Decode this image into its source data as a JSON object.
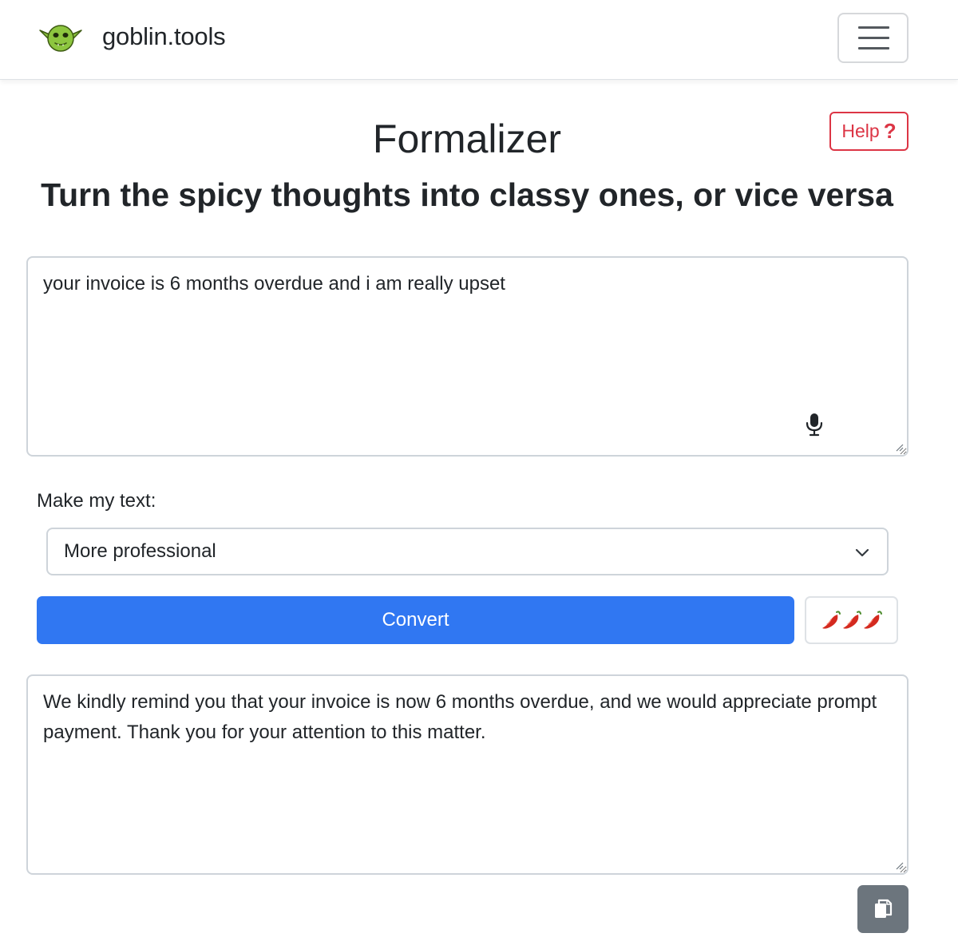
{
  "navbar": {
    "brand_text": "goblin.tools",
    "logo_icon": "goblin-logo-icon",
    "menu_icon": "hamburger-menu-icon"
  },
  "header": {
    "title": "Formalizer",
    "subtitle": "Turn the spicy thoughts into classy ones, or vice versa",
    "help_label": "Help",
    "help_icon": "question-mark-icon"
  },
  "input": {
    "value": "your invoice is 6 months overdue and i am really upset",
    "mic_icon": "microphone-icon"
  },
  "options": {
    "label": "Make my text:",
    "selected": "More professional"
  },
  "actions": {
    "convert_label": "Convert",
    "spiciness_icon": "chili-pepper-icon",
    "spiciness_level": 3
  },
  "output": {
    "value": "We kindly remind you that your invoice is now 6 months overdue, and we would appreciate prompt payment. Thank you for your attention to this matter.",
    "copy_icon": "copy-icon"
  },
  "colors": {
    "primary": "#3077f2",
    "danger": "#dc3545",
    "secondary": "#6c757d",
    "goblin_green": "#8dc63f"
  }
}
